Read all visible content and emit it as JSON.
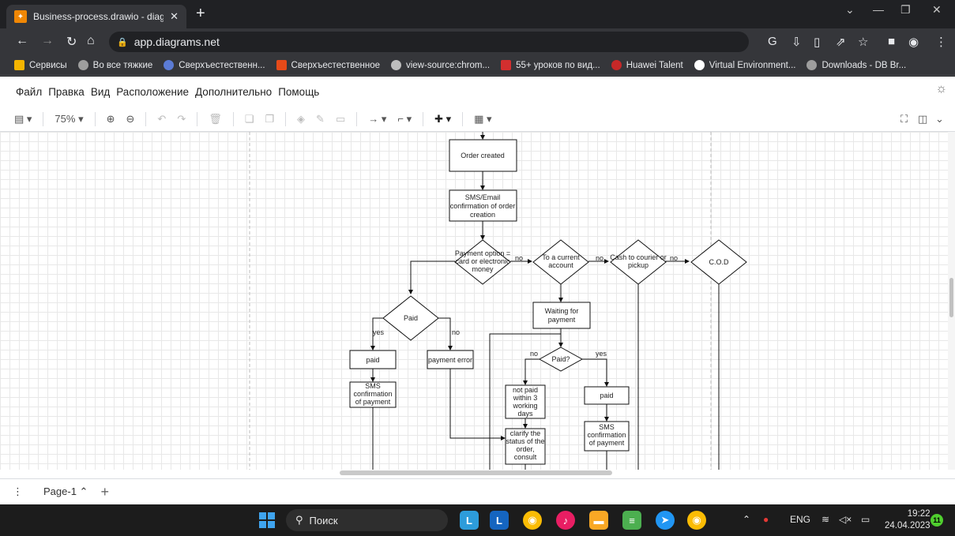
{
  "browser": {
    "tab_title": "Business-process.drawio - diagra",
    "tab_close": "✕",
    "new_tab": "+",
    "url": "app.diagrams.net",
    "bookmarks": [
      {
        "label": "Сервисы",
        "color": "#f4b400"
      },
      {
        "label": "Во все тяжкие",
        "color": "#9e9e9e"
      },
      {
        "label": "Сверхъестественн...",
        "color": "#5b7bd5"
      },
      {
        "label": "Сверхъестественное",
        "color": "#e64a19"
      },
      {
        "label": "view-source:chrom...",
        "color": "#bdbdbd"
      },
      {
        "label": "55+ уроков по вид...",
        "color": "#d32f2f"
      },
      {
        "label": "Huawei Talent",
        "color": "#c62828"
      },
      {
        "label": "Virtual Environment...",
        "color": "#ffffff"
      },
      {
        "label": "Downloads - DB Br...",
        "color": "#9e9e9e"
      }
    ]
  },
  "menu": {
    "items": [
      "Файл",
      "Правка",
      "Вид",
      "Расположение",
      "Дополнительно",
      "Помощь"
    ]
  },
  "toolbar": {
    "zoom": "75%"
  },
  "diagram": {
    "nodes": {
      "order_created": "Order created",
      "sms_email_1": "SMS/Email",
      "sms_email_2": "confirmation of order",
      "sms_email_3": "creation",
      "payment_option_1": "Payment option =",
      "payment_option_2": "card or electronic",
      "payment_option_3": "money",
      "current_account_1": "To a current",
      "current_account_2": "account",
      "cash_courier_1": "Cash to courier or",
      "cash_courier_2": "pickup",
      "cod": "C.O.D",
      "paid_diamond": "Paid",
      "waiting_1": "Waiting for",
      "waiting_2": "payment",
      "paid_q": "Paid?",
      "paid_left": "paid",
      "payment_error": "payment error",
      "sms_pay_left_1": "SMS",
      "sms_pay_left_2": "confirmation",
      "sms_pay_left_3": "of payment",
      "not_paid_1": "not paid",
      "not_paid_2": "within 3",
      "not_paid_3": "working",
      "not_paid_4": "days",
      "paid_right": "paid",
      "clarify_1": "clarify the",
      "clarify_2": "status of the",
      "clarify_3": "order,",
      "clarify_4": "consult",
      "sms_pay_right_1": "SMS",
      "sms_pay_right_2": "confirmation",
      "sms_pay_right_3": "of payment"
    },
    "labels": {
      "no": "no",
      "yes": "yes"
    }
  },
  "pages": {
    "current": "Page-1 ⌃",
    "add": "+"
  },
  "taskbar": {
    "search": "Поиск",
    "lang": "ENG",
    "time": "19:22",
    "date": "24.04.2023",
    "notifications": "11"
  }
}
